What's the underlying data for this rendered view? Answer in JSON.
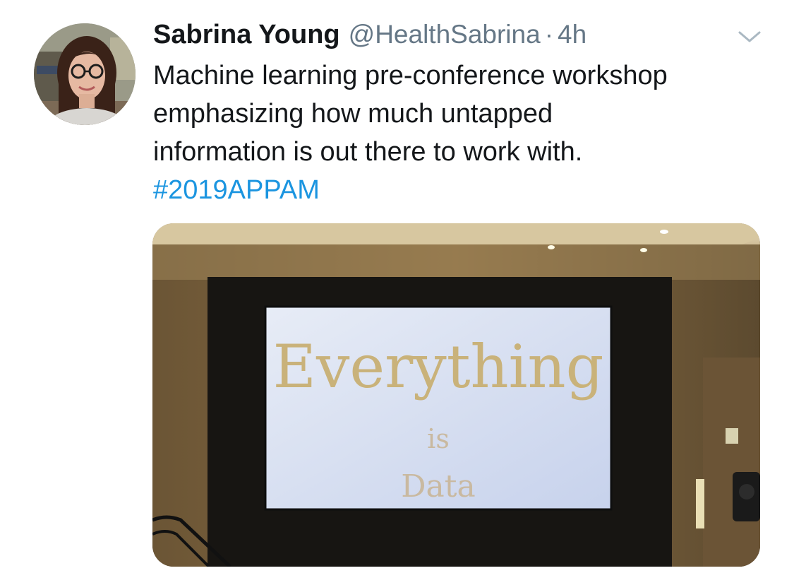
{
  "tweet": {
    "author": {
      "display_name": "Sabrina Young",
      "handle": "@HealthSabrina",
      "separator": "·",
      "timestamp": "4h"
    },
    "text_lines": [
      "Machine learning pre-conference workshop",
      "emphasizing how much untapped",
      "information is out there to work with."
    ],
    "hashtag": "#2019APPAM",
    "media": {
      "slide_lines": [
        "Everything",
        "is",
        "Data"
      ]
    }
  },
  "icons": {
    "avatar": "avatar-photo",
    "menu": "chevron-down-icon"
  },
  "colors": {
    "text": "#14171a",
    "secondary": "#657786",
    "link": "#1b95e0",
    "slide_text": "#c9b27a"
  }
}
